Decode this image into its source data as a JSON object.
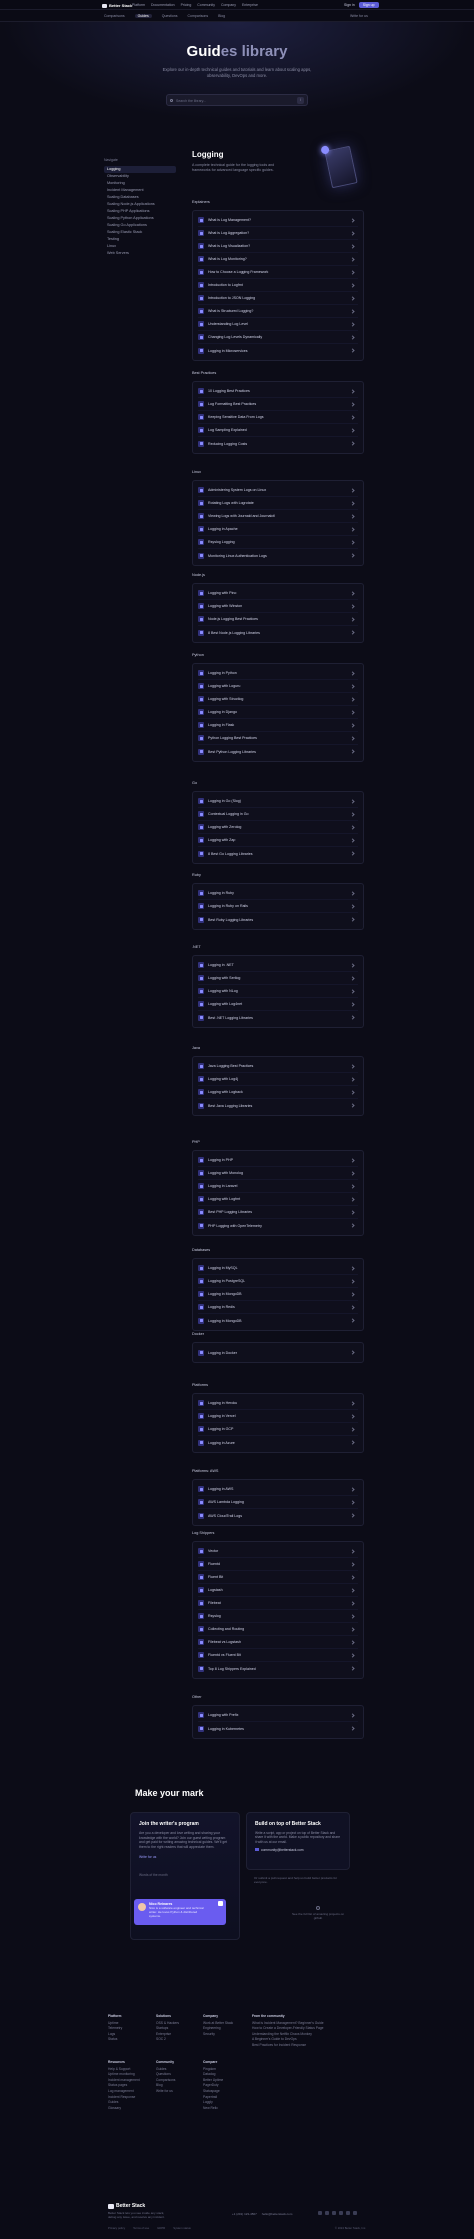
{
  "nav": {
    "brand": "Better Stack",
    "items": [
      "Platform",
      "Documentation",
      "Pricing",
      "Community",
      "Company",
      "Enterprise"
    ],
    "signin": "Sign in",
    "cta": "Sign up"
  },
  "subnav": {
    "items": [
      "Comparisons",
      "Guides",
      "Questions",
      "Comparisons",
      "Blog"
    ],
    "active": 1,
    "right": "Write for us"
  },
  "hero": {
    "title_a": "Guid",
    "title_b": "es library",
    "subtitle": "Explore our in-depth technical guides and tutorials and learn about scaling apps, observability, DevOps and more.",
    "search_placeholder": "Search the library...",
    "kbd": "/"
  },
  "sidebar": {
    "heading": "Navigate",
    "items": [
      "Logging",
      "Observability",
      "Monitoring",
      "Incident Management",
      "Scaling Databases",
      "Scaling Node.js Applications",
      "Scaling PHP Applications",
      "Scaling Python Applications",
      "Scaling Go Applications",
      "Scaling Elastic Stack",
      "Testing",
      "Linux",
      "Web Servers"
    ],
    "active": 0
  },
  "main": {
    "title": "Logging",
    "lead": "A complete technical guide for the logging tools and frameworks for advanced language specific guides."
  },
  "sections": [
    {
      "title": "Explainers",
      "items": [
        "What is Log Management?",
        "What is Log Aggregation?",
        "What is Log Visualization?",
        "What is Log Monitoring?",
        "How to Choose a Logging Framework",
        "Introduction to Logfmt",
        "Introduction to JSON Logging",
        "What is Structured Logging?",
        "Understanding Log Level",
        "Changing Log Levels Dynamically",
        "Logging in Microservices"
      ]
    },
    {
      "title": "Best Practices",
      "items": [
        "10 Logging Best Practices",
        "Log Formatting Best Practices",
        "Keeping Sensitive Data From Logs",
        "Log Sampling Explained",
        "Reducing Logging Costs"
      ]
    },
    {
      "title": "Linux",
      "items": [
        "Administering System Logs on Linux",
        "Rotating Logs with Logrotate",
        "Viewing Logs with Journald and Journalctl",
        "Logging in Apache",
        "Rsyslog Logging",
        "Monitoring Linux Authentication Logs"
      ]
    },
    {
      "title": "Node.js",
      "items": [
        "Logging with Pino",
        "Logging with Winston",
        "Node.js Logging Best Practices",
        "8 Best Node.js Logging Libraries"
      ]
    },
    {
      "title": "Python",
      "items": [
        "Logging in Python",
        "Logging with Loguru",
        "Logging with Structlog",
        "Logging in Django",
        "Logging in Flask",
        "Python Logging Best Practices",
        "Best Python Logging Libraries"
      ]
    },
    {
      "title": "Go",
      "items": [
        "Logging in Go (Slog)",
        "Contextual Logging in Go",
        "Logging with Zerolog",
        "Logging with Zap",
        "8 Best Go Logging Libraries"
      ]
    },
    {
      "title": "Ruby",
      "items": [
        "Logging in Ruby",
        "Logging in Ruby on Rails",
        "Best Ruby Logging Libraries"
      ]
    },
    {
      "title": ".NET",
      "items": [
        "Logging in .NET",
        "Logging with Serilog",
        "Logging with NLog",
        "Logging with Log4net",
        "Best .NET Logging Libraries"
      ]
    },
    {
      "title": "Java",
      "items": [
        "Java Logging Best Practices",
        "Logging with Log4j",
        "Logging with Logback",
        "Best Java Logging Libraries"
      ]
    },
    {
      "title": "PHP",
      "items": [
        "Logging in PHP",
        "Logging with Monolog",
        "Logging in Laravel",
        "Logging with Logfmt",
        "Best PHP Logging Libraries",
        "PHP Logging with OpenTelemetry"
      ]
    },
    {
      "title": "Databases",
      "items": [
        "Logging in MySQL",
        "Logging in PostgreSQL",
        "Logging in MongoDB",
        "Logging in Redis",
        "Logging in MongoDB"
      ]
    },
    {
      "title": "Docker",
      "items": [
        "Logging in Docker"
      ]
    },
    {
      "title": "Platforms",
      "items": [
        "Logging in Heroku",
        "Logging in Vercel",
        "Logging in GCP",
        "Logging in Azure"
      ]
    },
    {
      "title": "Platforms: AWS",
      "items": [
        "Logging in AWS",
        "AWS Lambda Logging",
        "AWS CloudTrail Logs"
      ]
    },
    {
      "title": "Log Shippers",
      "items": [
        "Vector",
        "Fluentd",
        "Fluent Bit",
        "Logstash",
        "Filebeat",
        "Rsyslog",
        "Collecting and Routing",
        "Filebeat vs Logstash",
        "Fluentd vs Fluent Bit",
        "Top 8 Log Shippers Explained"
      ]
    },
    {
      "title": "Other",
      "items": [
        "Logging with Prefix",
        "Logging in Kubernetes"
      ]
    }
  ],
  "mark": {
    "title": "Make your mark",
    "writer_title": "Join the writer's program",
    "writer_text": "Are you a developer and love writing and sharing your knowledge with the world? Join our guest writing program and get paid for writing amazing technical guides. We'll get them to the right readers that will appreciate them.",
    "writer_link": "Write for us",
    "writer_note": "Words of the month",
    "person_name": "Nico Reinares",
    "person_quote": "Nico is a software engineer and technical writer. He loves Python & distributed systems.",
    "build_title": "Build on top of Better Stack",
    "build_text": "Write a script, app or project on top of Better Stack and share it with the world. Make a public repository and share it with us at our email.",
    "build_email": "community@betterstack.com",
    "build_note": "Or submit a pull request and help us build better products for everyone.",
    "ad_text": "See the full list of amazing projects on github"
  },
  "footer": {
    "cols": [
      {
        "title": "Platform",
        "items": [
          "Uptime",
          "Telemetry",
          "Logs",
          "Status"
        ]
      },
      {
        "title": "Solutions",
        "items": [
          "OSS & Hackers",
          "Startups",
          "Enterprise",
          "SOC 2"
        ]
      },
      {
        "title": "Company",
        "items": [
          "Work at Better Stack",
          "Engineering",
          "Security"
        ]
      },
      {
        "title": "From the community",
        "items": [
          "What is Incident Management? Beginner's Guide",
          "How to Create a Developer-Friendly Status Page",
          "Understanding the Netflix Chaos Monkey",
          "A Beginner's Guide to DevOps",
          "Best Practices for Incident Response"
        ]
      },
      {
        "title": "Resources",
        "items": [
          "Help & Support",
          "Uptime monitoring",
          "Incident management",
          "Status pages",
          "Log management",
          "Incident Response",
          "Guides",
          "Glossary"
        ]
      },
      {
        "title": "Community",
        "items": [
          "Guides",
          "Questions",
          "Comparisons",
          "Blog",
          "Write for us"
        ]
      },
      {
        "title": "Compare",
        "items": [
          "Pingdom",
          "Datadog",
          "Better Uptime",
          "PagerDuty",
          "Statuspage",
          "Papertrail",
          "Loggly",
          "New Relic"
        ]
      }
    ],
    "brand": "Better Stack",
    "tagline": "Better Stack lets you see inside any stack, debug any issue, and resolve any incident.",
    "phone": "+1 (201) 123-4567",
    "email": "hello@betterstack.com",
    "bottom": [
      "Privacy policy",
      "Terms of use",
      "GDPR",
      "System status"
    ],
    "copyright": "© 2024 Better Stack, Inc."
  }
}
